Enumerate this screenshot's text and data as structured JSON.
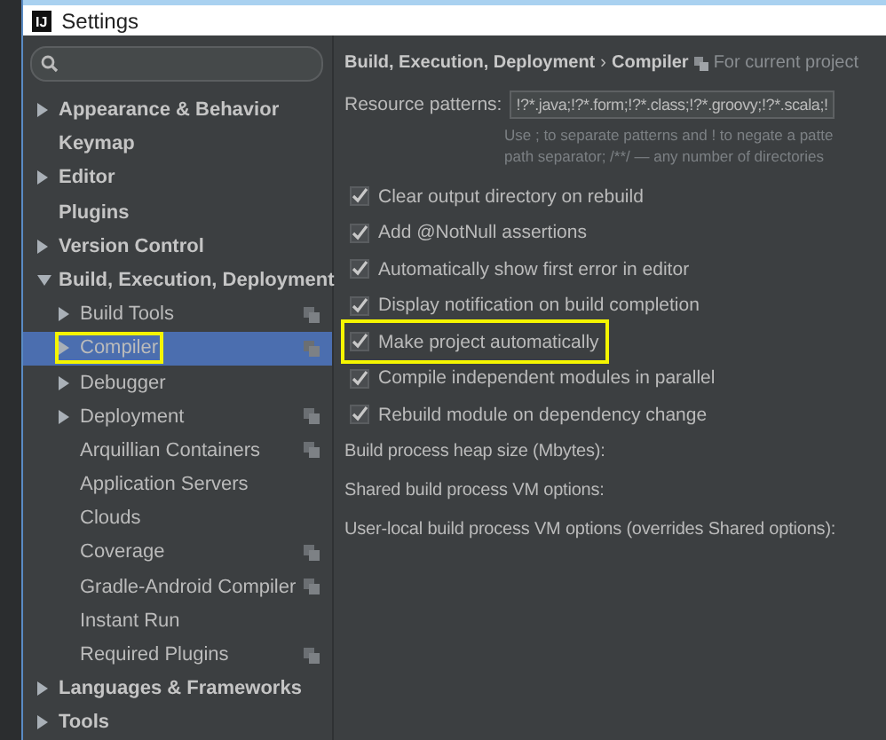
{
  "window": {
    "title": "Settings",
    "logo": "IJ"
  },
  "sidebar": {
    "items": [
      {
        "label": "Appearance & Behavior",
        "kind": "collapsed",
        "selected": false,
        "highlighted": false,
        "project_icon": false
      },
      {
        "label": "Keymap",
        "kind": "leaf",
        "selected": false,
        "highlighted": false,
        "project_icon": false
      },
      {
        "label": "Editor",
        "kind": "collapsed",
        "selected": false,
        "highlighted": false,
        "project_icon": false
      },
      {
        "label": "Plugins",
        "kind": "leaf",
        "selected": false,
        "highlighted": false,
        "project_icon": false
      },
      {
        "label": "Version Control",
        "kind": "collapsed",
        "selected": false,
        "highlighted": false,
        "project_icon": false
      },
      {
        "label": "Build, Execution, Deployment",
        "kind": "expanded",
        "selected": false,
        "highlighted": false,
        "project_icon": false,
        "children": [
          {
            "label": "Build Tools",
            "kind": "collapsed",
            "selected": false,
            "highlighted": false,
            "project_icon": true
          },
          {
            "label": "Compiler",
            "kind": "collapsed",
            "selected": true,
            "highlighted": true,
            "project_icon": true
          },
          {
            "label": "Debugger",
            "kind": "collapsed",
            "selected": false,
            "highlighted": false,
            "project_icon": false
          },
          {
            "label": "Deployment",
            "kind": "collapsed",
            "selected": false,
            "highlighted": false,
            "project_icon": true
          },
          {
            "label": "Arquillian Containers",
            "kind": "leaf",
            "selected": false,
            "highlighted": false,
            "project_icon": true
          },
          {
            "label": "Application Servers",
            "kind": "leaf",
            "selected": false,
            "highlighted": false,
            "project_icon": false
          },
          {
            "label": "Clouds",
            "kind": "leaf",
            "selected": false,
            "highlighted": false,
            "project_icon": false
          },
          {
            "label": "Coverage",
            "kind": "leaf",
            "selected": false,
            "highlighted": false,
            "project_icon": true
          },
          {
            "label": "Gradle-Android Compiler",
            "kind": "leaf",
            "selected": false,
            "highlighted": false,
            "project_icon": true
          },
          {
            "label": "Instant Run",
            "kind": "leaf",
            "selected": false,
            "highlighted": false,
            "project_icon": false
          },
          {
            "label": "Required Plugins",
            "kind": "leaf",
            "selected": false,
            "highlighted": false,
            "project_icon": true
          }
        ]
      },
      {
        "label": "Languages & Frameworks",
        "kind": "collapsed",
        "selected": false,
        "highlighted": false,
        "project_icon": false
      },
      {
        "label": "Tools",
        "kind": "collapsed",
        "selected": false,
        "highlighted": false,
        "project_icon": false
      }
    ]
  },
  "content": {
    "breadcrumb": {
      "parent": "Build, Execution, Deployment",
      "separator": "›",
      "current": "Compiler",
      "note": "For current project"
    },
    "resource_patterns": {
      "label": "Resource patterns:",
      "value": "!?*.java;!?*.form;!?*.class;!?*.groovy;!?*.scala;!",
      "hint": [
        "Use ; to separate patterns and ! to negate a patte",
        "path separator; /**/ — any number of directories"
      ]
    },
    "options": [
      {
        "label": "Clear output directory on rebuild",
        "checked": true,
        "highlighted": false
      },
      {
        "label": "Add @NotNull assertions",
        "checked": true,
        "highlighted": false
      },
      {
        "label": "Automatically show first error in editor",
        "checked": true,
        "highlighted": false
      },
      {
        "label": "Display notification on build completion",
        "checked": true,
        "highlighted": false
      },
      {
        "label": "Make project automatically",
        "checked": true,
        "highlighted": true
      },
      {
        "label": "Compile independent modules in parallel",
        "checked": true,
        "highlighted": false
      },
      {
        "label": "Rebuild module on dependency change",
        "checked": true,
        "highlighted": false
      }
    ],
    "labels": [
      "Build process heap size (Mbytes):",
      "Shared build process VM options:",
      "User-local build process VM options (overrides Shared options):"
    ]
  }
}
